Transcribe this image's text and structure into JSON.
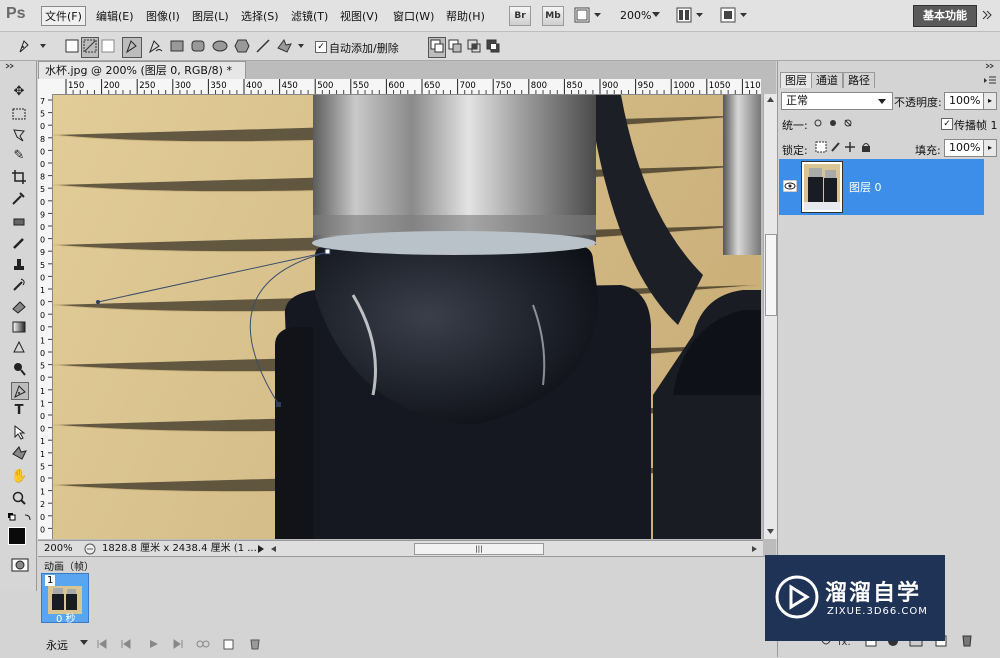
{
  "app": {
    "logo": "Ps"
  },
  "menu": [
    "文件(F)",
    "编辑(E)",
    "图像(I)",
    "图层(L)",
    "选择(S)",
    "滤镜(T)",
    "视图(V)",
    "窗口(W)",
    "帮助(H)"
  ],
  "appbar": {
    "br": "Br",
    "mb": "Mb",
    "zoom": "200%",
    "workspace": "基本功能"
  },
  "options": {
    "auto_add_delete": "自动添加/删除"
  },
  "document": {
    "tab_title": "水杯.jpg @ 200% (图层 0, RGB/8) *",
    "ruler_top": [
      "150",
      "200",
      "250",
      "300",
      "350",
      "400",
      "450",
      "500",
      "550",
      "600",
      "650",
      "700",
      "750",
      "800",
      "850",
      "900",
      "950",
      "1000",
      "1050",
      "1100"
    ],
    "ruler_left": [
      "7",
      "5",
      "0",
      "8",
      "0",
      "0",
      "8",
      "5",
      "0",
      "9",
      "0",
      "0",
      "9",
      "5",
      "0",
      "1",
      "0",
      "0",
      "0",
      "1",
      "0",
      "5",
      "0",
      "1",
      "1",
      "0",
      "0",
      "1",
      "1",
      "5",
      "0",
      "1",
      "2",
      "0",
      "0"
    ],
    "status_zoom": "200%",
    "status_info": "1828.8 厘米 x 2438.4 厘米 (1 ..."
  },
  "layers_panel": {
    "tabs": [
      "图层",
      "通道",
      "路径"
    ],
    "blend_mode": "正常",
    "opacity_label": "不透明度:",
    "opacity": "100%",
    "unify_label": "统一:",
    "propagate_label": "传播帧 1",
    "lock_label": "锁定:",
    "fill_label": "填充:",
    "fill": "100%",
    "layer_name": "图层 0"
  },
  "animation_panel": {
    "title": "动画（帧）",
    "frame_number": "1",
    "frame_delay": "0 秒",
    "loop": "永远"
  },
  "watermark": {
    "brand": "溜溜自学",
    "url": "ZIXUE.3D66.COM"
  },
  "colors": {
    "selection_blue": "#3d8ee8",
    "panel_gray": "#d4d4d4",
    "watermark_bg": "#1f3356"
  }
}
